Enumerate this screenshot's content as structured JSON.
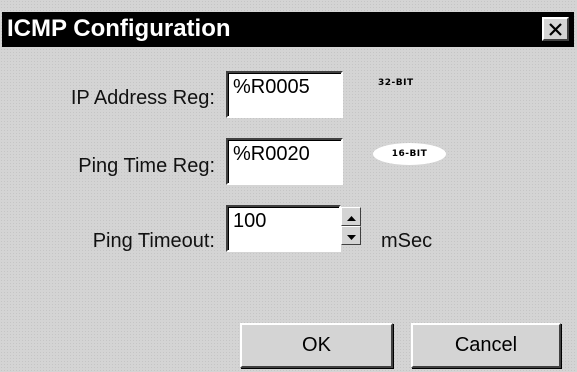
{
  "window": {
    "title": "ICMP Configuration",
    "close_glyph": "✕"
  },
  "fields": {
    "ip_address": {
      "label": "IP Address Reg:",
      "value": "%R0005",
      "badge": "32-BIT"
    },
    "ping_time": {
      "label": "Ping Time Reg:",
      "value": "%R0020",
      "badge": "16-BIT"
    },
    "ping_timeout": {
      "label": "Ping Timeout:",
      "value": "100",
      "unit": "mSec"
    }
  },
  "buttons": {
    "ok_label": "OK",
    "cancel_label": "Cancel"
  },
  "icons": {
    "close": "close-icon",
    "spin_up": "arrow-up-icon",
    "spin_down": "arrow-down-icon"
  },
  "colors": {
    "titlebar": "#000000",
    "title_text": "#ffffff",
    "dialog_bg": "#d4d4d4"
  }
}
